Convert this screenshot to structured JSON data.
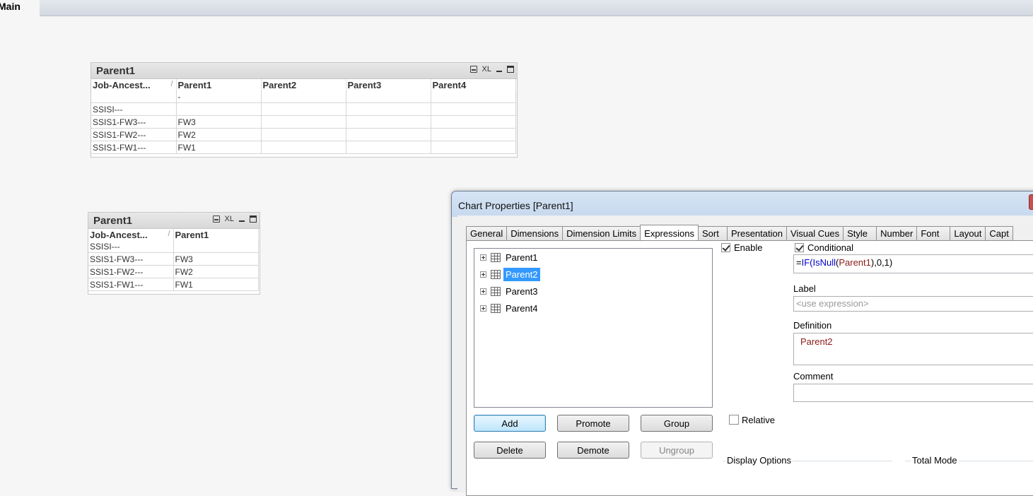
{
  "sheet_tab": "Main",
  "table1": {
    "title": "Parent1",
    "tools": {
      "xl": "XL"
    },
    "columns": [
      "Job-Ancest...",
      "Parent1",
      "Parent2",
      "Parent3",
      "Parent4"
    ],
    "sort_indicator": "/",
    "rows": [
      [
        "",
        "-",
        "",
        "",
        ""
      ],
      [
        "SSISI---",
        "",
        "",
        "",
        ""
      ],
      [
        "SSIS1-FW3---",
        "FW3",
        "",
        "",
        ""
      ],
      [
        "SSIS1-FW2---",
        "FW2",
        "",
        "",
        ""
      ],
      [
        "SSIS1-FW1---",
        "FW1",
        "",
        "",
        ""
      ]
    ]
  },
  "table2": {
    "title": "Parent1",
    "tools": {
      "xl": "XL"
    },
    "columns": [
      "Job-Ancest...",
      "Parent1"
    ],
    "sort_indicator": "/",
    "rows": [
      [
        "SSISI---",
        ""
      ],
      [
        "SSIS1-FW3---",
        "FW3"
      ],
      [
        "SSIS1-FW2---",
        "FW2"
      ],
      [
        "SSIS1-FW1---",
        "FW1"
      ]
    ]
  },
  "dialog": {
    "title": "Chart Properties [Parent1]",
    "tabs": [
      "General",
      "Dimensions",
      "Dimension Limits",
      "Expressions",
      "Sort",
      "Presentation",
      "Visual Cues",
      "Style",
      "Number",
      "Font",
      "Layout",
      "Capt"
    ],
    "active_tab": "Expressions",
    "expressions": [
      "Parent1",
      "Parent2",
      "Parent3",
      "Parent4"
    ],
    "selected_expression": "Parent2",
    "enable": {
      "label": "Enable",
      "checked": true
    },
    "conditional": {
      "label": "Conditional",
      "checked": true,
      "expr_prefix": "=",
      "expr_fn1": "IF(",
      "expr_fn2": "IsNull",
      "expr_p1": "(",
      "expr_field": "Parent1",
      "expr_rest": "),0,1)"
    },
    "label_field": {
      "label": "Label",
      "placeholder": "<use expression>"
    },
    "definition": {
      "label": "Definition",
      "value": "Parent2"
    },
    "comment": {
      "label": "Comment",
      "value": ""
    },
    "buttons": {
      "add": "Add",
      "promote": "Promote",
      "group": "Group",
      "delete": "Delete",
      "demote": "Demote",
      "ungroup": "Ungroup"
    },
    "relative": {
      "label": "Relative",
      "checked": false
    },
    "display_options_label": "Display Options",
    "total_mode_label": "Total Mode"
  },
  "colors": {
    "selection": "#3399ff",
    "function": "#0000cc",
    "field": "#8b1a1a"
  }
}
